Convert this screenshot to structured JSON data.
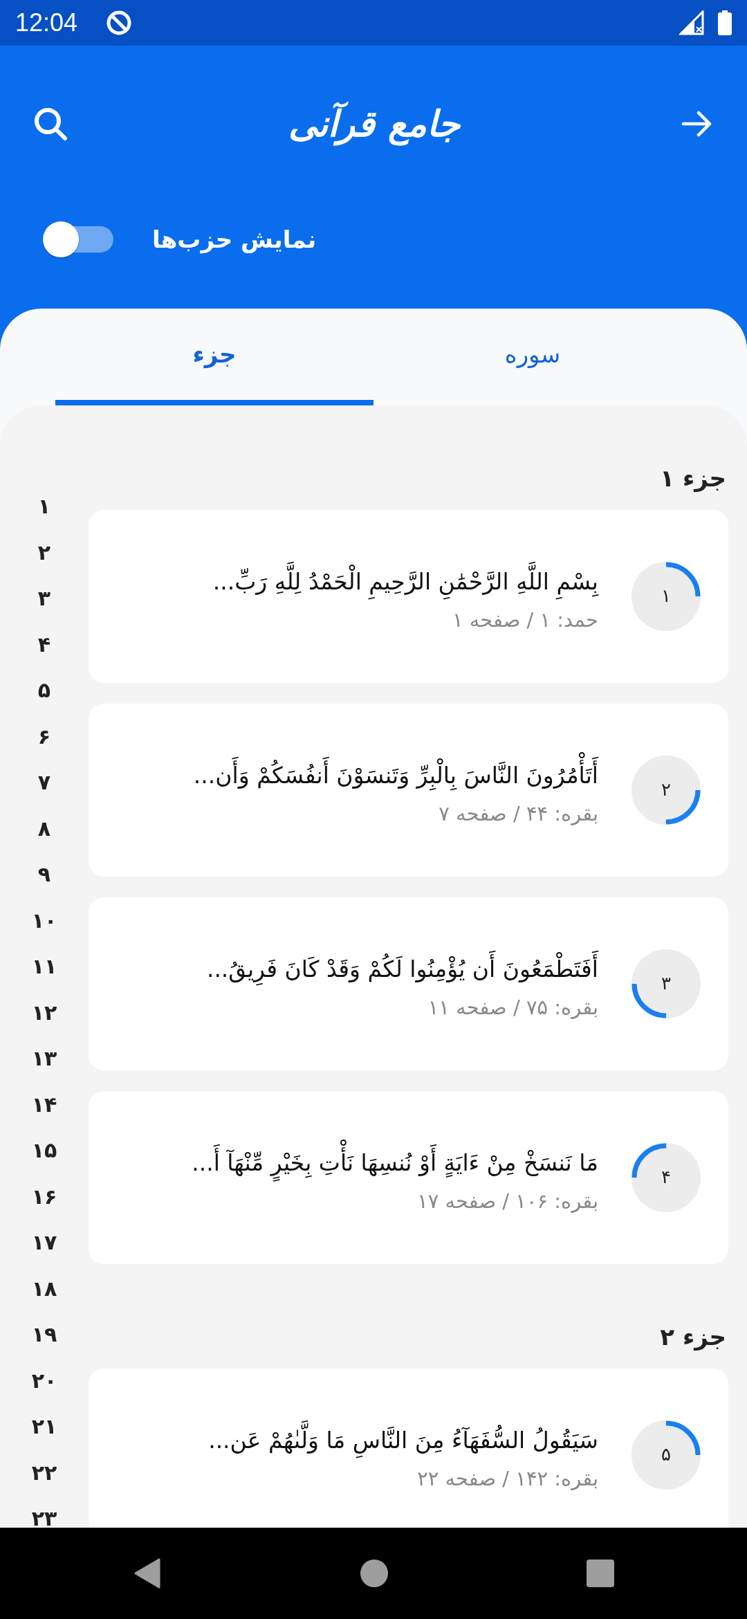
{
  "status_bar": {
    "time": "12:04"
  },
  "header": {
    "logo": "جامع قرآنی"
  },
  "hizb_toggle": {
    "label": "نمایش حزب‌ها",
    "on": false
  },
  "tabs": [
    {
      "label": "سوره",
      "selected": false
    },
    {
      "label": "جزء",
      "selected": true
    }
  ],
  "sections": [
    {
      "title": "جزء ۱",
      "items": [
        {
          "number": "۱",
          "text": "بِسْمِ اللَّهِ الرَّحْمَٰنِ الرَّحِيمِ الْحَمْدُ لِلَّهِ رَبِّ...",
          "reference": "حمد: ۱ / صفحه ۱",
          "kind": "first"
        },
        {
          "number": "۲",
          "text": "أَتَأْمُرُونَ النَّاسَ بِالْبِرِّ وَتَنسَوْنَ أَنفُسَكُمْ وَأَن...",
          "reference": "بقره: ۴۴ / صفحه ۷",
          "kind": "second"
        },
        {
          "number": "۳",
          "text": "أَفَتَطْمَعُونَ أَن يُؤْمِنُوا لَكُمْ وَقَدْ كَانَ فَرِيقُ...",
          "reference": "بقره: ۷۵ / صفحه ۱۱",
          "kind": "third"
        },
        {
          "number": "۴",
          "text": "مَا نَنسَخْ مِنْ ءَايَةٍ أَوْ نُنسِهَا نَأْتِ بِخَيْرٍ مِّنْهَآ أَ...",
          "reference": "بقره: ۱۰۶ / صفحه ۱۷",
          "kind": "fourth"
        }
      ]
    },
    {
      "title": "جزء ۲",
      "items": [
        {
          "number": "۵",
          "text": "سَيَقُولُ السُّفَهَآءُ مِنَ النَّاسِ مَا وَلَّىٰهُمْ عَن...",
          "reference": "بقره: ۱۴۲ / صفحه ۲۲",
          "kind": "first"
        }
      ]
    }
  ],
  "index": [
    "۱",
    "۲",
    "۳",
    "۴",
    "۵",
    "۶",
    "۷",
    "۸",
    "۹",
    "۱۰",
    "۱۱",
    "۱۲",
    "۱۳",
    "۱۴",
    "۱۵",
    "۱۶",
    "۱۷",
    "۱۸",
    "۱۹",
    "۲۰",
    "۲۱",
    "۲۲",
    "۲۳"
  ]
}
